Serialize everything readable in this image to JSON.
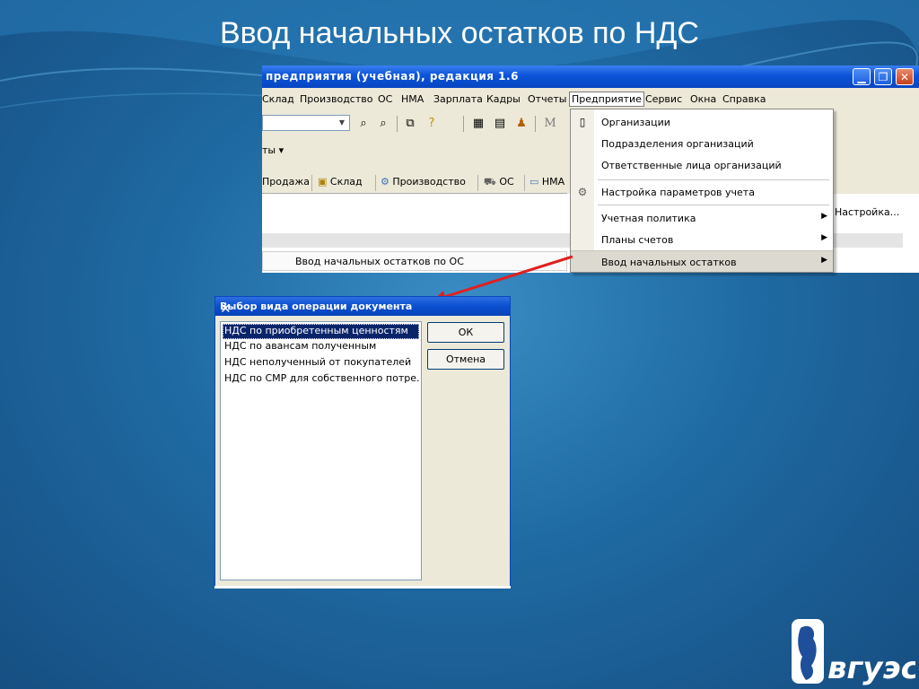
{
  "slide": {
    "title": "Ввод начальных остатков по НДС"
  },
  "window": {
    "title": "предприятия (учебная), редакция 1.6",
    "menu": [
      "Склад",
      "Производство",
      "ОС",
      "НМА",
      "Зарплата",
      "Кадры",
      "Отчеты",
      "Предприятие",
      "Сервис",
      "Окна",
      "Справка"
    ],
    "active_menu": "Предприятие",
    "toolbar2_label": "ты",
    "tabs": [
      "Продажа",
      "Склад",
      "Производство",
      "ОС",
      "НМА"
    ],
    "panel_row_label": "Ввод начальных остатков по ОС",
    "right_link": "Настройка..."
  },
  "dropdown": {
    "items": [
      {
        "label": "Организации",
        "icon": "document-icon",
        "submenu": false
      },
      {
        "label": "Подразделения организаций",
        "icon": "",
        "submenu": false
      },
      {
        "label": "Ответственные лица организаций",
        "icon": "",
        "submenu": false
      },
      {
        "label": "Настройка параметров учета",
        "icon": "gear-icon",
        "submenu": false
      },
      {
        "label": "Учетная политика",
        "icon": "",
        "submenu": true
      },
      {
        "label": "Планы счетов",
        "icon": "",
        "submenu": true
      },
      {
        "label": "Ввод начальных остатков",
        "icon": "",
        "submenu": true,
        "highlighted": true
      }
    ]
  },
  "dialog": {
    "title": "Выбор вида операции документа",
    "items": [
      "НДС по приобретенным ценностям",
      "НДС по авансам полученным",
      "НДС неполученный от покупателей",
      "НДС по СМР для собственного потре..."
    ],
    "selected_index": 0,
    "ok_label": "ОК",
    "cancel_label": "Отмена"
  },
  "logo": {
    "text": "вгуэс"
  },
  "colors": {
    "titlebar": "#0a53d8",
    "selection": "#0a246a",
    "arrow": "#e02020",
    "slide_bg": "#1f6aa3"
  }
}
